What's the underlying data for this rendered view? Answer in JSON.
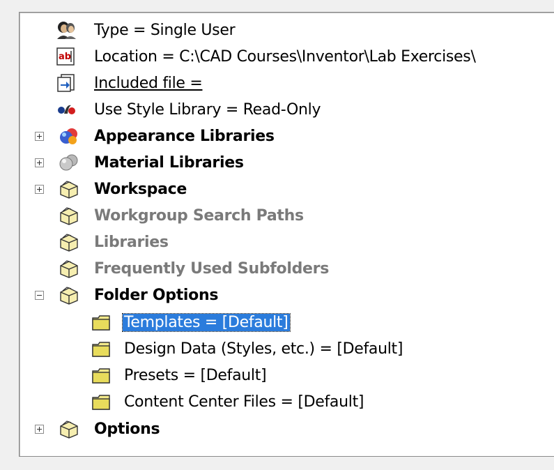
{
  "tree": {
    "items": [
      {
        "label": "Type = Single User",
        "icon": "user-type-icon"
      },
      {
        "label": "Location = C:\\CAD Courses\\Inventor\\Lab Exercises\\",
        "icon": "location-text-icon"
      },
      {
        "label": "Included file = ",
        "icon": "included-file-icon"
      },
      {
        "label": "Use Style Library = Read-Only",
        "icon": "style-library-icon"
      },
      {
        "label": "Appearance Libraries",
        "icon": "appearance-sphere-icon",
        "expander": "+"
      },
      {
        "label": "Material Libraries",
        "icon": "material-sphere-icon",
        "expander": "+"
      },
      {
        "label": "Workspace",
        "icon": "box-folder-icon",
        "expander": "+"
      },
      {
        "label": "Workgroup Search Paths",
        "icon": "box-folder-icon"
      },
      {
        "label": "Libraries",
        "icon": "box-folder-icon"
      },
      {
        "label": "Frequently Used Subfolders",
        "icon": "box-folder-icon"
      },
      {
        "label": "Folder Options",
        "icon": "box-folder-icon",
        "expander": "-"
      },
      {
        "label": "Templates = [Default]",
        "icon": "folder-icon",
        "selected": true
      },
      {
        "label": "Design Data (Styles, etc.) = [Default]",
        "icon": "folder-icon"
      },
      {
        "label": "Presets = [Default]",
        "icon": "folder-icon"
      },
      {
        "label": "Content Center Files = [Default]",
        "icon": "folder-icon"
      },
      {
        "label": "Options",
        "icon": "box-folder-icon",
        "expander": "+"
      }
    ]
  },
  "colors": {
    "selection": "#2b7cdc",
    "disabled_text": "#7a7a7a",
    "folder_yellow": "#f2e98a"
  }
}
